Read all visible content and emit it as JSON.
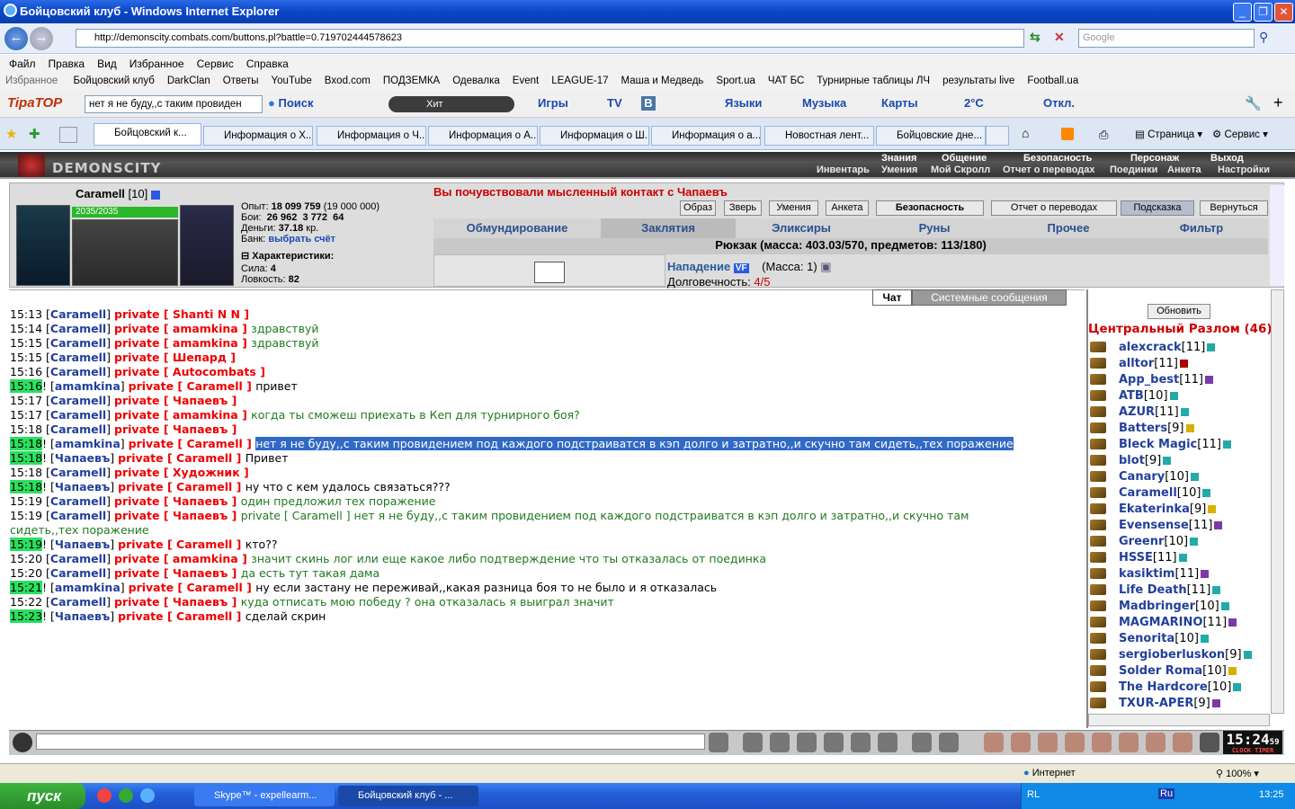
{
  "window": {
    "title": "Бойцовский клуб - Windows Internet Explorer"
  },
  "address": {
    "url": "http://demonscity.combats.com/buttons.pl?battle=0.719702444578623",
    "search_placeholder": "Google"
  },
  "menu": [
    "Файл",
    "Правка",
    "Вид",
    "Избранное",
    "Сервис",
    "Справка"
  ],
  "favorites_label": "Избранное",
  "favorites": [
    "Бойцовский клуб",
    "DarkClan",
    "Ответы",
    "YouTube",
    "Bxod.com",
    "ПОДЗЕМКА",
    "Одевалка",
    "Event",
    "LEAGUE-17",
    "Маша и Медведь",
    "Sport.ua",
    "ЧАТ БС",
    "Турнирные таблицы ЛЧ",
    "результаты live",
    "Football.ua"
  ],
  "toolbar": {
    "brand": "TipaTOP",
    "search_value": "нет я не буду,,с таким провиден",
    "search_label": "Поиск",
    "hit_label": "Хит",
    "games": "Игры",
    "tv": "TV",
    "languages": "Языки",
    "music": "Музыка",
    "maps": "Карты",
    "weather": "2°C",
    "otkl": "Откл."
  },
  "tabs": [
    "Бойцовский к...",
    "Информация о Х...",
    "Информация о Ч...",
    "Информация о А...",
    "Информация о Ш...",
    "Информация о а...",
    "Новостная лент...",
    "Бойцовские дне..."
  ],
  "tab_tools": {
    "page": "Страница",
    "service": "Сервис"
  },
  "game": {
    "logo": "DEMONSCITY",
    "nav_top": [
      "Знания",
      "Общение",
      "Безопасность",
      "Персонаж",
      "Выход"
    ],
    "nav_bottom": [
      "Инвентарь",
      "Умения",
      "Мой Скролл",
      "Отчет о переводах",
      "Поединки",
      "Анкета",
      "Настройки"
    ],
    "char": {
      "name": "Caramell",
      "level": "[10]",
      "hp": "2035/2035",
      "exp_label": "Опыт:",
      "exp": "18 099 759",
      "exp_next": "(19 000 000)",
      "fights_label": "Бои:",
      "wins": "26 962",
      "losses": "3 772",
      "draws": "64",
      "money_label": "Деньги:",
      "money": "37.18",
      "money_unit": "кр.",
      "bank_label": "Банк:",
      "bank_link": "выбрать счёт",
      "chars_label": "Характеристики:",
      "str_label": "Сила:",
      "str": "4",
      "agi_label": "Ловкость:",
      "agi": "82"
    },
    "alert": "Вы почувствовали мысленный контакт с Чапаевъ",
    "buttons": [
      "Образ",
      "Зверь",
      "Умения",
      "Анкета",
      "Безопасность",
      "Отчет о переводах",
      "Подсказка",
      "Вернуться"
    ],
    "inv_tabs": [
      "Обмундирование",
      "Заклятия",
      "Эликсиры",
      "Руны",
      "Прочее",
      "Фильтр"
    ],
    "rucksack": "Рюкзак (масса: 403.03/570, предметов: 113/180)",
    "item": {
      "name": "Нападение",
      "badge": "VF",
      "mass": "(Масса: 1)",
      "dur_label": "Долговечность:",
      "dur": "4/5"
    },
    "chat_tabs": [
      "Чат",
      "Системные сообщения"
    ],
    "chat": [
      {
        "t": "15:13",
        "g": false,
        "pre": "",
        "from": "Caramell",
        "to": "Shanti N N",
        "msg": "",
        "k": "g"
      },
      {
        "t": "15:14",
        "g": false,
        "pre": "",
        "from": "Caramell",
        "to": "amamkina",
        "msg": "здравствуй",
        "k": "g"
      },
      {
        "t": "15:15",
        "g": false,
        "pre": "",
        "from": "Caramell",
        "to": "amamkina",
        "msg": "здравствуй",
        "k": "g"
      },
      {
        "t": "15:15",
        "g": false,
        "pre": "",
        "from": "Caramell",
        "to": "Шепард",
        "msg": "",
        "k": "g"
      },
      {
        "t": "15:16",
        "g": false,
        "pre": "",
        "from": "Caramell",
        "to": "Autocombats",
        "msg": "",
        "k": "g"
      },
      {
        "t": "15:16",
        "g": true,
        "pre": "!",
        "from": "amamkina",
        "to": "Caramell",
        "msg": "привет",
        "k": "k"
      },
      {
        "t": "15:17",
        "g": false,
        "pre": "",
        "from": "Caramell",
        "to": "Чапаевъ",
        "msg": "",
        "k": "g"
      },
      {
        "t": "15:17",
        "g": false,
        "pre": "",
        "from": "Caramell",
        "to": "amamkina",
        "msg": "когда ты сможеш приехать в Кеп для турнирного боя?",
        "k": "g"
      },
      {
        "t": "15:18",
        "g": false,
        "pre": "",
        "from": "Caramell",
        "to": "Чапаевъ",
        "msg": "",
        "k": "g"
      },
      {
        "t": "15:18",
        "g": true,
        "pre": "!",
        "from": "amamkina",
        "to": "Caramell",
        "msg": "нет я не буду,,с таким провидением под каждого подстраиватся в кэп долго и затратно,,и скучно там сидеть,,тех поражение",
        "k": "s"
      },
      {
        "t": "15:18",
        "g": true,
        "pre": "!",
        "from": "Чапаевъ",
        "to": "Caramell",
        "msg": "Привет",
        "k": "k"
      },
      {
        "t": "15:18",
        "g": false,
        "pre": "",
        "from": "Caramell",
        "to": "Художник",
        "msg": "",
        "k": "g"
      },
      {
        "t": "15:18",
        "g": true,
        "pre": "!",
        "from": "Чапаевъ",
        "to": "Caramell",
        "msg": "ну что с кем удалось связаться???",
        "k": "k"
      },
      {
        "t": "15:19",
        "g": false,
        "pre": "",
        "from": "Caramell",
        "to": "Чапаевъ",
        "msg": "один предложил тех поражение",
        "k": "g"
      },
      {
        "t": "15:19",
        "g": false,
        "pre": "",
        "from": "Caramell",
        "to": "Чапаевъ",
        "msg": "private [ Caramell ] нет я не буду,,с таким провидением под каждого подстраиватся в кэп долго и затратно,,и скучно там",
        "k": "g"
      },
      {
        "t": "",
        "g": false,
        "pre": "",
        "from": "",
        "to": "",
        "msg": "сидеть,,тех поражение",
        "k": "g"
      },
      {
        "t": "15:19",
        "g": true,
        "pre": "!",
        "from": "Чапаевъ",
        "to": "Caramell",
        "msg": "кто??",
        "k": "k"
      },
      {
        "t": "15:20",
        "g": false,
        "pre": "",
        "from": "Caramell",
        "to": "amamkina",
        "msg": "значит скинь лог или еще какое либо подтверждение что ты отказалась от поединка",
        "k": "g"
      },
      {
        "t": "15:20",
        "g": false,
        "pre": "",
        "from": "Caramell",
        "to": "Чапаевъ",
        "msg": "да есть тут такая дама",
        "k": "g"
      },
      {
        "t": "15:21",
        "g": true,
        "pre": "!",
        "from": "amamkina",
        "to": "Caramell",
        "msg": "ну если застану не переживай,,какая разница боя то не было и я отказалась",
        "k": "k"
      },
      {
        "t": "15:22",
        "g": false,
        "pre": "",
        "from": "Caramell",
        "to": "Чапаевъ",
        "msg": "куда отписать мою победу ? она отказалась я выиграл значит",
        "k": "g"
      },
      {
        "t": "15:23",
        "g": true,
        "pre": "!",
        "from": "Чапаевъ",
        "to": "Caramell",
        "msg": "сделай скрин",
        "k": "k"
      }
    ],
    "private_word": "private",
    "userlist": {
      "refresh": "Обновить",
      "title": "Центральный Разлом (46)",
      "users": [
        {
          "n": "alexcrack",
          "l": "[11]",
          "b": "c"
        },
        {
          "n": "alltor",
          "l": "[11]",
          "b": "r"
        },
        {
          "n": "App_best",
          "l": "[11]",
          "b": "p"
        },
        {
          "n": "ATB",
          "l": "[10]",
          "b": "c"
        },
        {
          "n": "AZUR",
          "l": "[11]",
          "b": "c"
        },
        {
          "n": "Batters",
          "l": "[9]",
          "b": "y"
        },
        {
          "n": "Bleck Magic",
          "l": "[11]",
          "b": "c"
        },
        {
          "n": "blot",
          "l": "[9]",
          "b": "c"
        },
        {
          "n": "Canary",
          "l": "[10]",
          "b": "c"
        },
        {
          "n": "Caramell",
          "l": "[10]",
          "b": "c"
        },
        {
          "n": "Ekaterinka",
          "l": "[9]",
          "b": "y"
        },
        {
          "n": "Evensense",
          "l": "[11]",
          "b": "p"
        },
        {
          "n": "Greenr",
          "l": "[10]",
          "b": "c"
        },
        {
          "n": "HSSE",
          "l": "[11]",
          "b": "c"
        },
        {
          "n": "kasiktim",
          "l": "[11]",
          "b": "p"
        },
        {
          "n": "Life Death",
          "l": "[11]",
          "b": "c"
        },
        {
          "n": "Madbringer",
          "l": "[10]",
          "b": "c"
        },
        {
          "n": "MAGMARINO",
          "l": "[11]",
          "b": "p"
        },
        {
          "n": "Senorita",
          "l": "[10]",
          "b": "c"
        },
        {
          "n": "sergioberluskon",
          "l": "[9]",
          "b": "c"
        },
        {
          "n": "Solder Roma",
          "l": "[10]",
          "b": "y"
        },
        {
          "n": "The Hardcore",
          "l": "[10]",
          "b": "c"
        },
        {
          "n": "TXUR-APER",
          "l": "[9]",
          "b": "p"
        }
      ]
    },
    "clock": "15:24",
    "clock_sec": "59",
    "clock_label": "CLOCK TIMER"
  },
  "statusbar": {
    "zone": "Интернет",
    "zoom": "100%"
  },
  "taskbar": {
    "start": "пуск",
    "items": [
      "Skype™ - expellearm...",
      "Бойцовский клуб - ..."
    ],
    "lang": "RL",
    "lang2": "Ru",
    "time": "13:25"
  }
}
